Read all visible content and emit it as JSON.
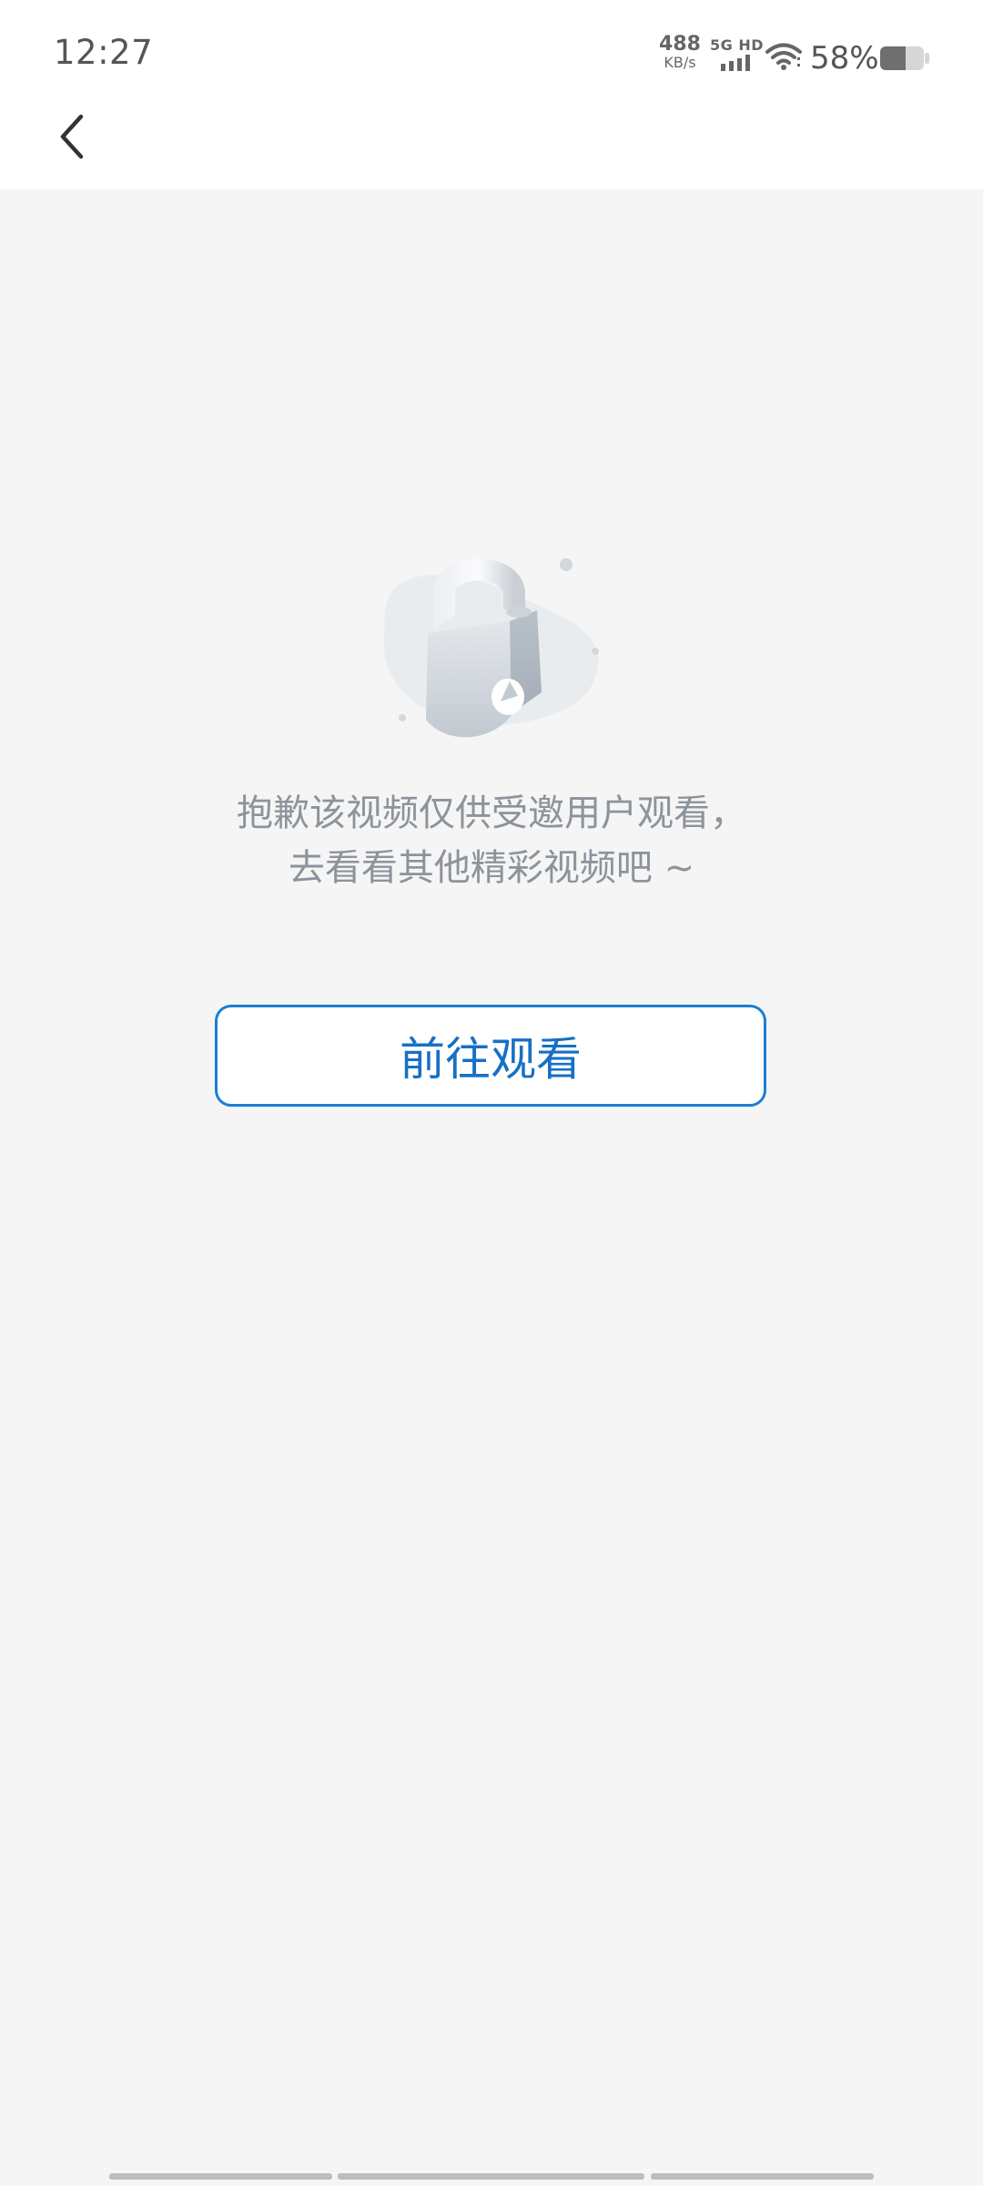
{
  "status_bar": {
    "time": "12:27",
    "net_speed_value": "488",
    "net_speed_unit": "KB/s",
    "network_label": "5G HD",
    "battery_percent": "58%",
    "icons": [
      "signal-icon",
      "wifi-icon",
      "battery-icon"
    ]
  },
  "nav": {
    "back_icon": "chevron-left-icon"
  },
  "empty_state": {
    "illustration_icon": "lock-icon",
    "message_line1": "抱歉该视频仅供受邀用户观看，",
    "message_line2": "去看看其他精彩视频吧 ~",
    "button_label": "前往观看"
  },
  "colors": {
    "accent": "#1670c4",
    "message_text": "#8c939b",
    "background": "#f5f5f5"
  }
}
